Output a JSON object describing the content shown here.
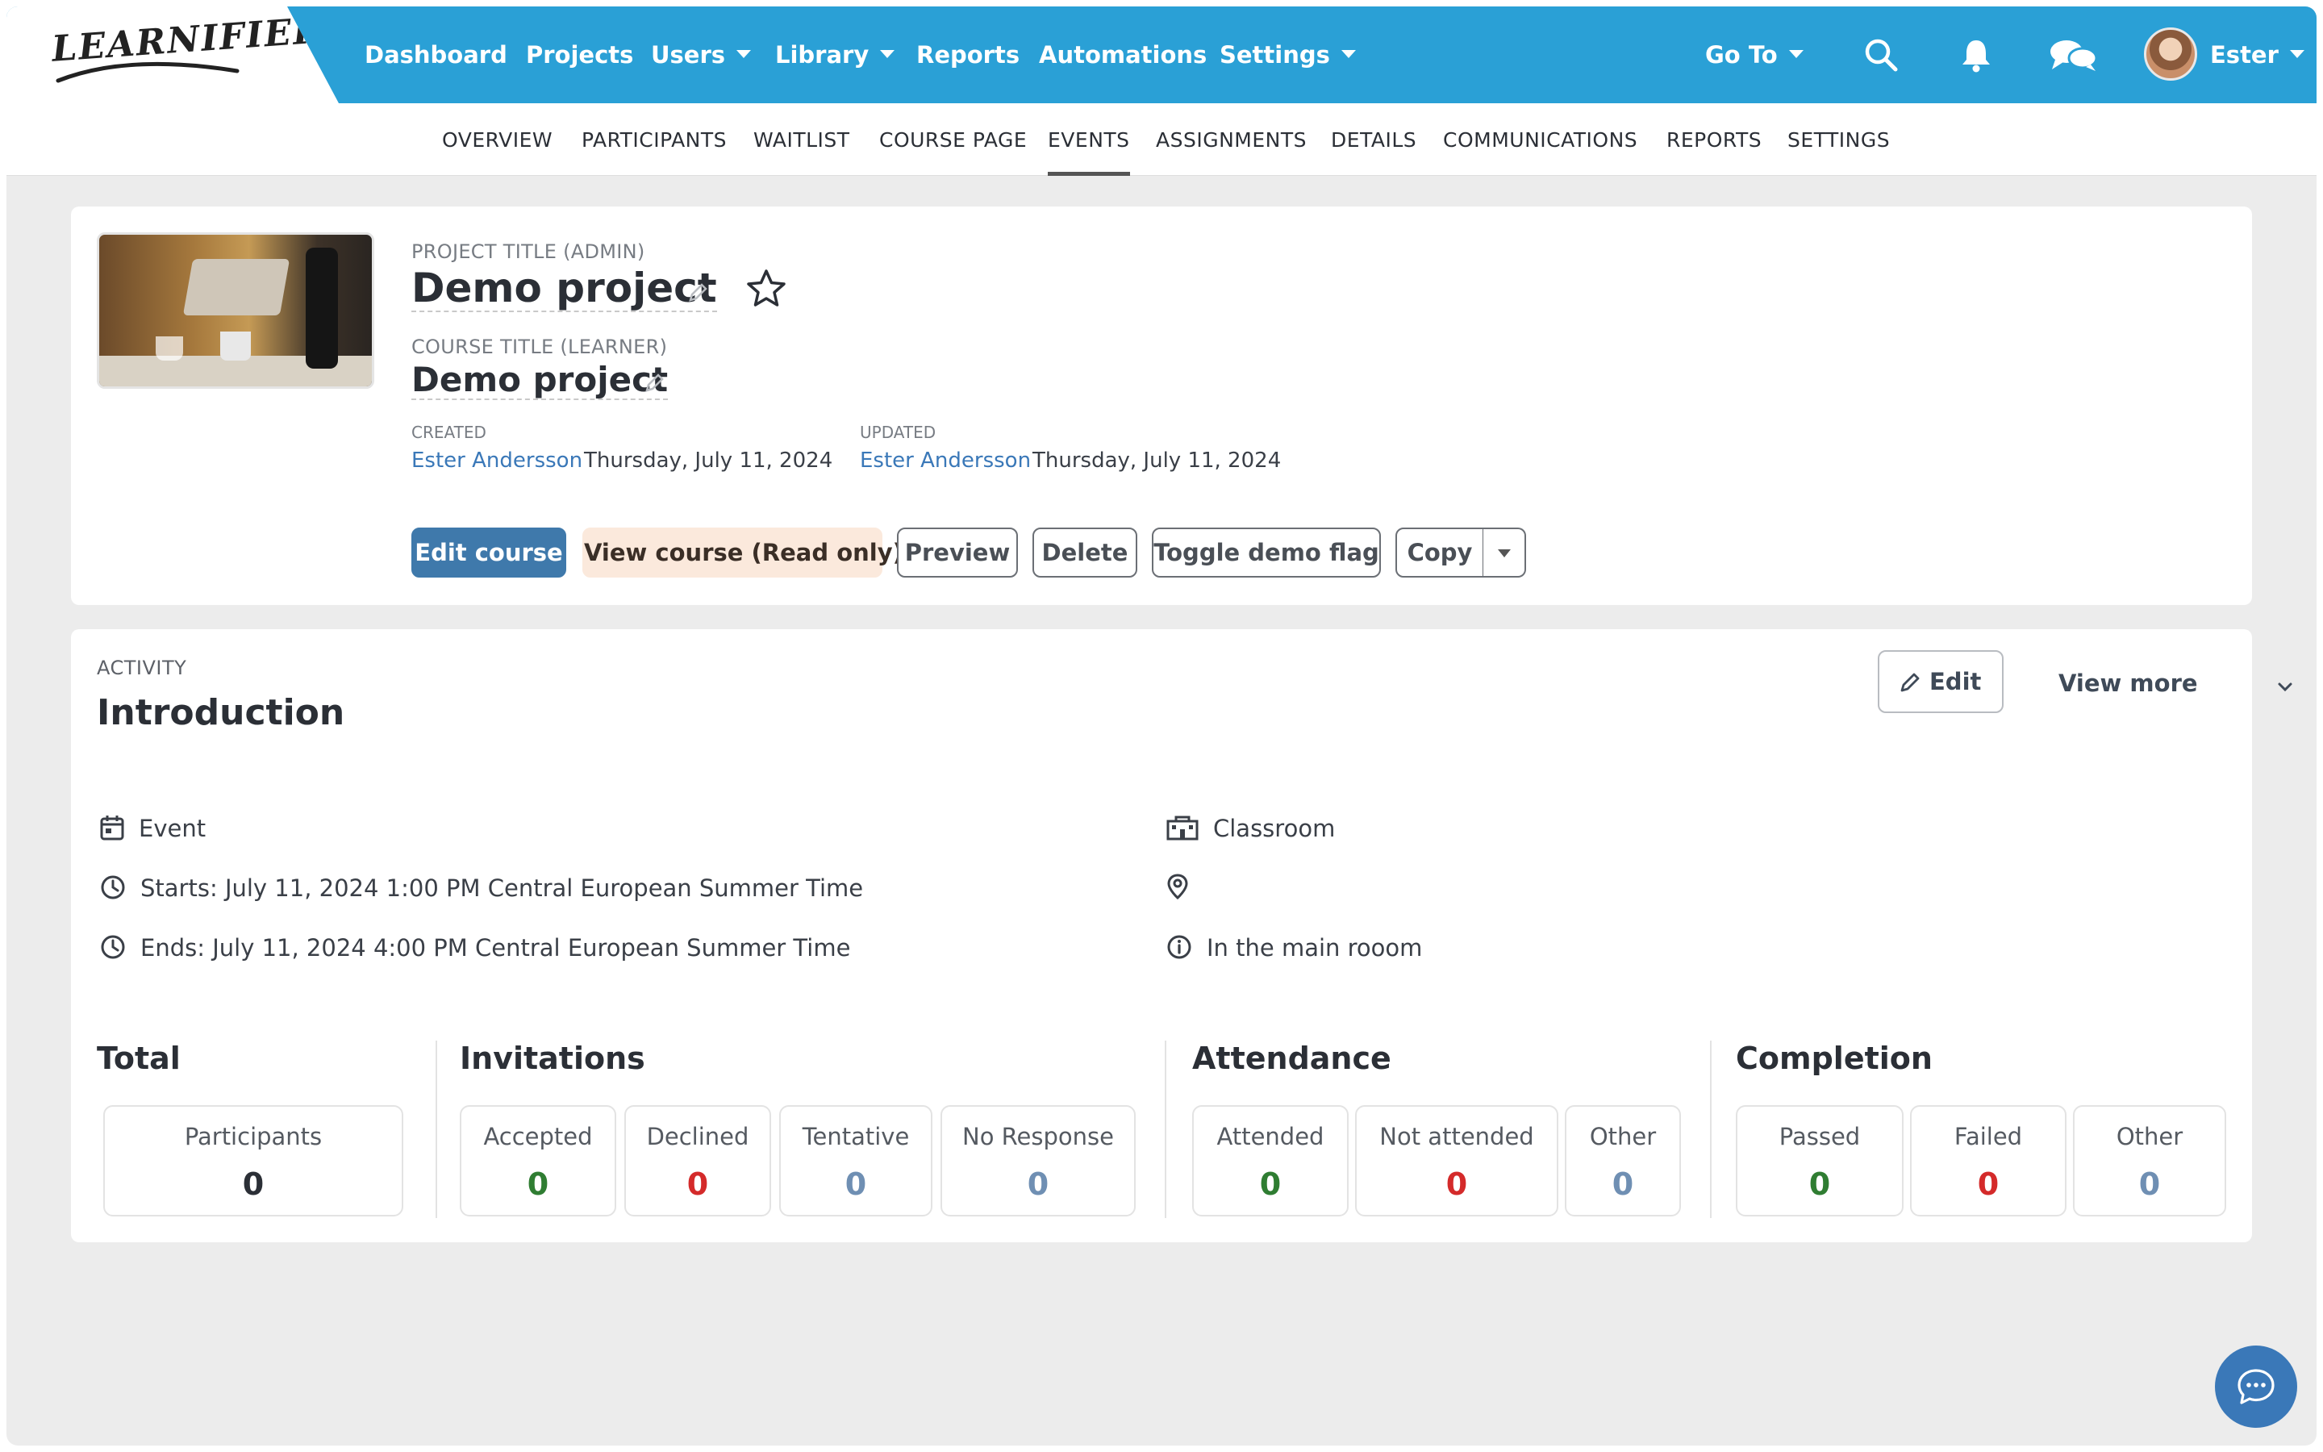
{
  "brand": {
    "logo_text": "LEARNIFIER"
  },
  "topnav": {
    "items": [
      {
        "label": "Dashboard"
      },
      {
        "label": "Projects"
      },
      {
        "label": "Users"
      },
      {
        "label": "Library"
      },
      {
        "label": "Reports"
      },
      {
        "label": "Automations"
      },
      {
        "label": "Settings"
      }
    ],
    "goto_label": "Go To",
    "user_name": "Ester"
  },
  "subnav": {
    "items": [
      {
        "label": "OVERVIEW"
      },
      {
        "label": "PARTICIPANTS"
      },
      {
        "label": "WAITLIST"
      },
      {
        "label": "COURSE PAGE"
      },
      {
        "label": "EVENTS"
      },
      {
        "label": "ASSIGNMENTS"
      },
      {
        "label": "DETAILS"
      },
      {
        "label": "COMMUNICATIONS"
      },
      {
        "label": "REPORTS"
      },
      {
        "label": "SETTINGS"
      }
    ],
    "active": "EVENTS"
  },
  "project": {
    "project_title_label": "PROJECT TITLE (ADMIN)",
    "project_title": "Demo project",
    "course_title_label": "COURSE TITLE (LEARNER)",
    "course_title": "Demo project",
    "created_label": "CREATED",
    "created_by": "Ester Andersson",
    "created_date": "Thursday, July 11, 2024",
    "updated_label": "UPDATED",
    "updated_by": "Ester Andersson",
    "updated_date": "Thursday, July 11, 2024",
    "buttons": {
      "edit_course": "Edit course",
      "view_course": "View course (Read only)",
      "preview": "Preview",
      "delete": "Delete",
      "toggle_demo": "Toggle demo flag",
      "copy": "Copy"
    }
  },
  "activity": {
    "label": "ACTIVITY",
    "title": "Introduction",
    "edit_label": "Edit",
    "view_more_label": "View more",
    "type": "Event",
    "starts": "Starts: July 11, 2024 1:00 PM Central European Summer Time",
    "ends": "Ends: July 11, 2024 4:00 PM Central European Summer Time",
    "location_type": "Classroom",
    "location": "",
    "note": "In the main rooom"
  },
  "stats": {
    "total": {
      "title": "Total",
      "items": [
        {
          "label": "Participants",
          "value": "0"
        }
      ]
    },
    "invitations": {
      "title": "Invitations",
      "items": [
        {
          "label": "Accepted",
          "value": "0"
        },
        {
          "label": "Declined",
          "value": "0"
        },
        {
          "label": "Tentative",
          "value": "0"
        },
        {
          "label": "No Response",
          "value": "0"
        }
      ]
    },
    "attendance": {
      "title": "Attendance",
      "items": [
        {
          "label": "Attended",
          "value": "0"
        },
        {
          "label": "Not attended",
          "value": "0"
        },
        {
          "label": "Other",
          "value": "0"
        }
      ]
    },
    "completion": {
      "title": "Completion",
      "items": [
        {
          "label": "Passed",
          "value": "0"
        },
        {
          "label": "Failed",
          "value": "0"
        },
        {
          "label": "Other",
          "value": "0"
        }
      ]
    }
  },
  "colors": {
    "topbar": "#2aa0d6",
    "primary_button": "#3f79ab",
    "positive": "#2f7d32",
    "negative": "#d42a2a",
    "neutral": "#6f8fb3"
  }
}
